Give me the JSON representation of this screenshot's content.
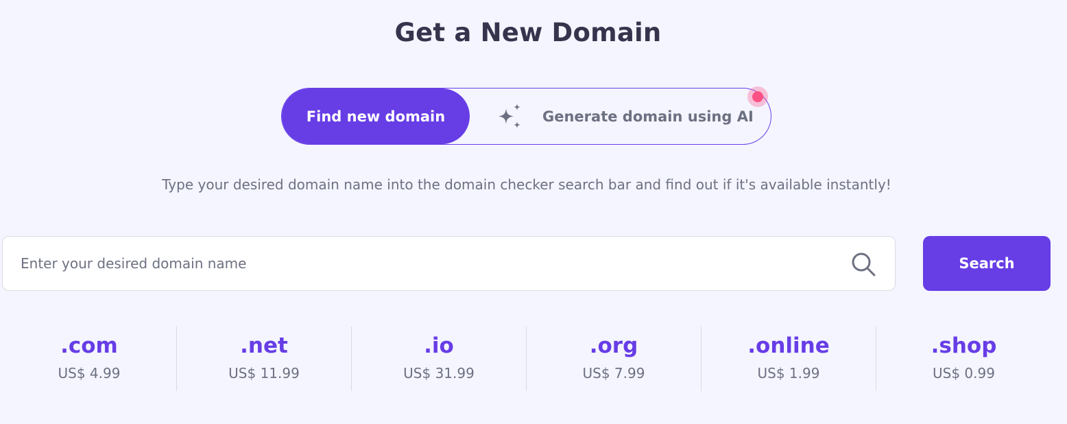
{
  "header": {
    "title": "Get a New Domain"
  },
  "toggle": {
    "find_label": "Find new domain",
    "ai_label": "Generate domain using AI",
    "ai_icon": "sparkle-icon"
  },
  "subtitle": "Type your desired domain name into the domain checker search bar and find out if it's available instantly!",
  "search": {
    "placeholder": "Enter your desired domain name",
    "value": "",
    "button_label": "Search",
    "icon": "search-icon"
  },
  "tlds": [
    {
      "name": ".com",
      "price": "US$ 4.99"
    },
    {
      "name": ".net",
      "price": "US$ 11.99"
    },
    {
      "name": ".io",
      "price": "US$ 31.99"
    },
    {
      "name": ".org",
      "price": "US$ 7.99"
    },
    {
      "name": ".online",
      "price": "US$ 1.99"
    },
    {
      "name": ".shop",
      "price": "US$ 0.99"
    }
  ],
  "colors": {
    "accent": "#673de6",
    "background": "#f4f5ff",
    "heading": "#36344d",
    "muted": "#6d7081",
    "notification": "#fc5185"
  }
}
